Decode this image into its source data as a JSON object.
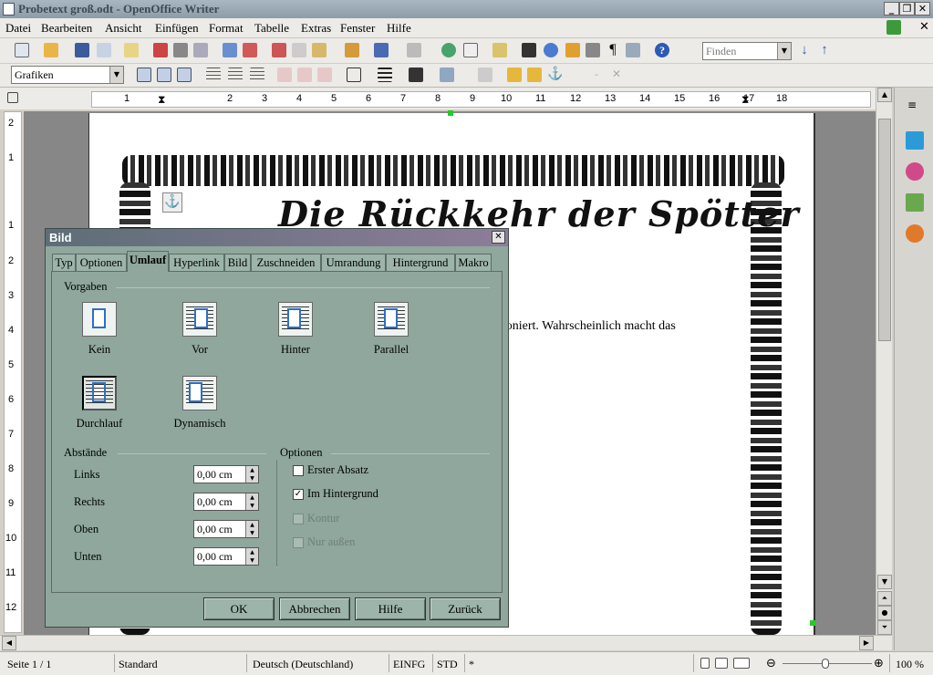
{
  "window": {
    "title": "Probetext groß.odt - OpenOffice Writer"
  },
  "menubar": [
    "Datei",
    "Bearbeiten",
    "Ansicht",
    "Einfügen",
    "Format",
    "Tabelle",
    "Extras",
    "Fenster",
    "Hilfe"
  ],
  "toolbar": {
    "find_placeholder": "Finden",
    "style_value": "Grafiken"
  },
  "ruler": {
    "h_ticks": [
      "1",
      "2",
      "3",
      "4",
      "5",
      "6",
      "7",
      "8",
      "9",
      "10",
      "11",
      "12",
      "13",
      "14",
      "15",
      "16",
      "17",
      "18"
    ],
    "v_ticks": [
      "2",
      "1",
      "1",
      "2",
      "3",
      "4",
      "5",
      "6",
      "7",
      "8",
      "9",
      "10",
      "11",
      "12"
    ]
  },
  "document": {
    "title": "Die Rückkehr der Spötter",
    "text_fragment": "ktioniert. Wahrscheinlich macht das"
  },
  "dialog": {
    "title": "Bild",
    "tabs": [
      "Typ",
      "Optionen",
      "Umlauf",
      "Hyperlink",
      "Bild",
      "Zuschneiden",
      "Umrandung",
      "Hintergrund",
      "Makro"
    ],
    "active_tab": "Umlauf",
    "presets_label": "Vorgaben",
    "presets": [
      "Kein",
      "Vor",
      "Hinter",
      "Parallel",
      "Durchlauf",
      "Dynamisch"
    ],
    "selected_preset": "Durchlauf",
    "spacing_label": "Abstände",
    "spacing": [
      {
        "label": "Links",
        "value": "0,00 cm"
      },
      {
        "label": "Rechts",
        "value": "0,00 cm"
      },
      {
        "label": "Oben",
        "value": "0,00 cm"
      },
      {
        "label": "Unten",
        "value": "0,00 cm"
      }
    ],
    "options_label": "Optionen",
    "options": [
      {
        "label": "Erster Absatz",
        "checked": false,
        "enabled": true
      },
      {
        "label": "Im Hintergrund",
        "checked": true,
        "enabled": true
      },
      {
        "label": "Kontur",
        "checked": false,
        "enabled": false
      },
      {
        "label": "Nur außen",
        "checked": false,
        "enabled": false
      }
    ],
    "buttons": {
      "ok": "OK",
      "cancel": "Abbrechen",
      "help": "Hilfe",
      "back": "Zurück"
    }
  },
  "statusbar": {
    "page": "Seite 1 / 1",
    "style": "Standard",
    "language": "Deutsch (Deutschland)",
    "insert_mode": "EINFG",
    "selection_mode": "STD",
    "modified": "*",
    "zoom": "100 %"
  },
  "colors": {
    "dialog_bg": "#8fa79d",
    "titlebar_dialog": "#5d6e77",
    "doc_bg": "#878787"
  }
}
